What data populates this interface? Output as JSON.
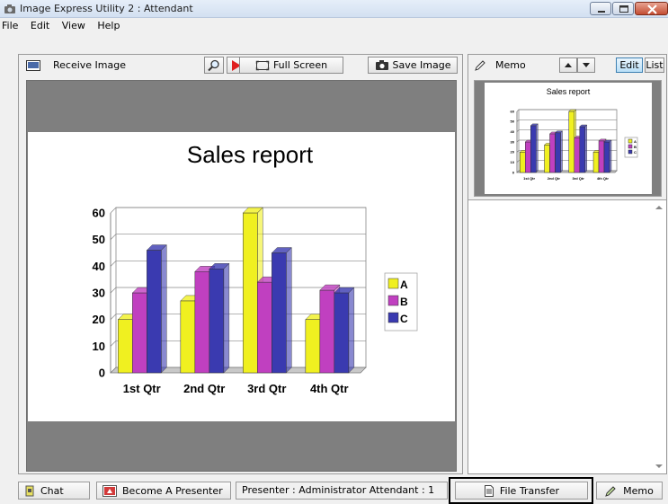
{
  "window": {
    "title": "Image Express Utility 2 : Attendant"
  },
  "menu": [
    "File",
    "Edit",
    "View",
    "Help"
  ],
  "left_panel": {
    "label": "Receive Image",
    "full_screen_label": "Full Screen",
    "save_image_label": "Save Image"
  },
  "right_panel": {
    "label": "Memo",
    "edit_label": "Edit",
    "list_label": "List"
  },
  "statusbar": {
    "chat_label": "Chat",
    "become_presenter_label": "Become A Presenter",
    "presenter_info": "Presenter : Administrator   Attendant : 1",
    "file_transfer_label": "File Transfer",
    "memo_label": "Memo"
  },
  "colors": {
    "series_A": "#f0f020",
    "series_B": "#c040c0",
    "series_C": "#3a3ab0",
    "titlebar": "#d3e0f1",
    "close_button": "#c34d33"
  },
  "icons": {
    "app": "camera-icon",
    "receive": "monitor-icon",
    "zoom": "magnifier-icon",
    "pointer": "red-arrow-icon",
    "fullscreen": "fullscreen-icon",
    "save": "camera-icon",
    "memo": "pencil-icon",
    "chat": "chat-icon",
    "presenter": "presenter-icon",
    "file_transfer": "document-icon"
  },
  "chart_data": {
    "type": "bar",
    "title": "Sales report",
    "categories": [
      "1st Qtr",
      "2nd Qtr",
      "3rd Qtr",
      "4th Qtr"
    ],
    "series": [
      {
        "name": "A",
        "values": [
          20,
          27,
          60,
          20
        ]
      },
      {
        "name": "B",
        "values": [
          30,
          38,
          34,
          31
        ]
      },
      {
        "name": "C",
        "values": [
          46,
          39,
          45,
          30
        ]
      }
    ],
    "ylim": [
      0,
      60
    ],
    "yticks": [
      0,
      10,
      20,
      30,
      40,
      50,
      60
    ],
    "legend": "right",
    "grid": true
  }
}
